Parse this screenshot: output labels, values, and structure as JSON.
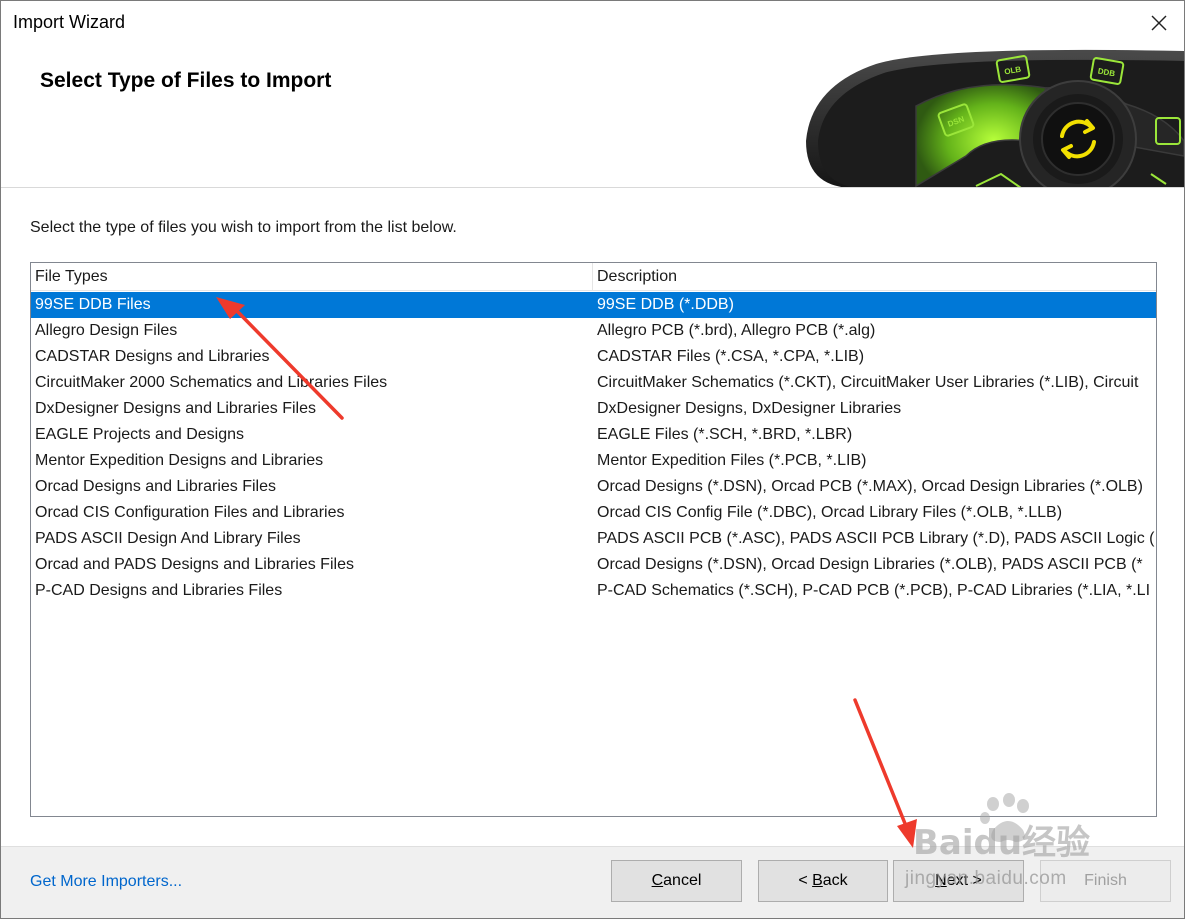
{
  "window": {
    "title": "Import Wizard"
  },
  "header": {
    "heading": "Select Type of Files to Import",
    "banner_badges": [
      "OLB",
      "DDB",
      "DSN"
    ]
  },
  "instruction": "Select the type of files you wish to import from the list below.",
  "list": {
    "columns": [
      "File Types",
      "Description"
    ],
    "selected_index": 0,
    "rows": [
      {
        "type": "99SE DDB Files",
        "description": "99SE DDB (*.DDB)"
      },
      {
        "type": "Allegro Design Files",
        "description": "Allegro PCB (*.brd), Allegro PCB (*.alg)"
      },
      {
        "type": "CADSTAR Designs and Libraries",
        "description": "CADSTAR Files (*.CSA, *.CPA, *.LIB)"
      },
      {
        "type": "CircuitMaker 2000 Schematics and Libraries Files",
        "description": "CircuitMaker Schematics (*.CKT), CircuitMaker User Libraries (*.LIB), Circuit"
      },
      {
        "type": "DxDesigner Designs and Libraries Files",
        "description": "DxDesigner Designs, DxDesigner Libraries"
      },
      {
        "type": "EAGLE Projects and Designs",
        "description": "EAGLE Files (*.SCH, *.BRD, *.LBR)"
      },
      {
        "type": "Mentor Expedition Designs and Libraries",
        "description": "Mentor Expedition Files (*.PCB, *.LIB)"
      },
      {
        "type": "Orcad Designs and Libraries Files",
        "description": "Orcad Designs (*.DSN), Orcad PCB (*.MAX), Orcad Design Libraries (*.OLB)"
      },
      {
        "type": "Orcad CIS Configuration Files and Libraries",
        "description": "Orcad CIS Config File (*.DBC), Orcad Library Files (*.OLB, *.LLB)"
      },
      {
        "type": "PADS ASCII Design And Library Files",
        "description": "PADS ASCII PCB (*.ASC), PADS ASCII PCB Library (*.D), PADS ASCII Logic ("
      },
      {
        "type": "Orcad and PADS Designs and Libraries Files",
        "description": "Orcad Designs (*.DSN), Orcad Design Libraries (*.OLB), PADS ASCII PCB (*"
      },
      {
        "type": "P-CAD Designs and Libraries Files",
        "description": "P-CAD Schematics (*.SCH), P-CAD PCB (*.PCB), P-CAD Libraries (*.LIA, *.LI"
      }
    ]
  },
  "footer": {
    "link": "Get More Importers...",
    "cancel": {
      "accel": "C",
      "rest": "ancel"
    },
    "back": {
      "pre": "< ",
      "accel": "B",
      "rest": "ack"
    },
    "next": {
      "accel": "N",
      "rest": "ext >"
    },
    "finish": "Finish"
  },
  "watermark": {
    "brand": "Baidu经验",
    "url": "jingyan.baidu.com"
  },
  "colors": {
    "selection": "#0078d7",
    "link": "#0066cc",
    "arrow": "#ee3a2c",
    "accent_green": "#8fe31c"
  },
  "icons": [
    "close-icon",
    "sync-icon",
    "arrow-annotation"
  ]
}
